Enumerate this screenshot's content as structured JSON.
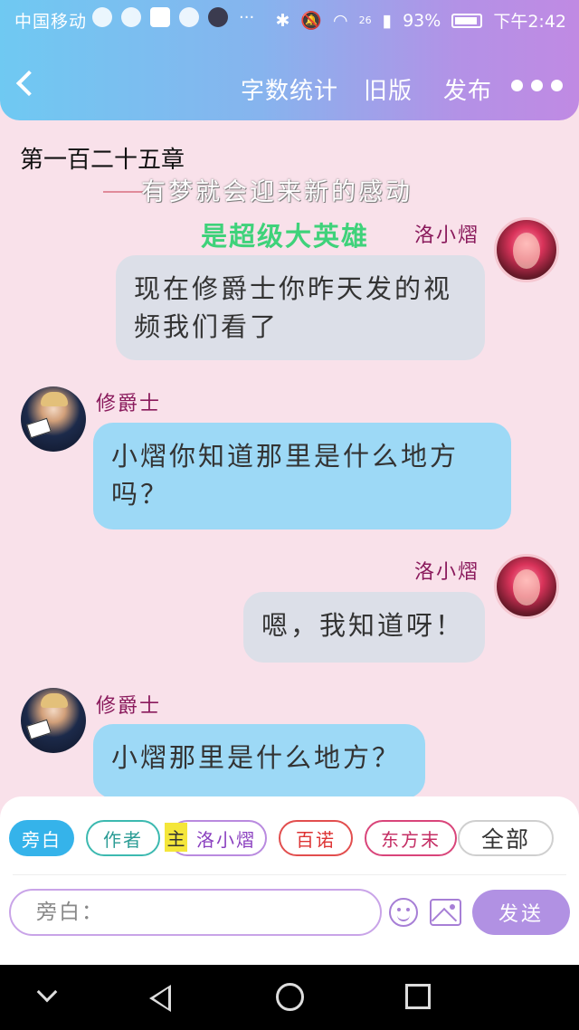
{
  "statusbar": {
    "carrier": "中国移动",
    "dots": "···",
    "network": "26",
    "battery": "93%",
    "time": "下午2:42"
  },
  "header": {
    "word_count": "字数统计",
    "old_version": "旧版",
    "publish": "发布"
  },
  "chapter_title": "第一百二十五章",
  "banners": {
    "line1": "有梦就会迎来新的感动",
    "line2": "是超级大英雄"
  },
  "messages": [
    {
      "speaker": "洛小熠",
      "side": "right",
      "text": "现在修爵士你昨天发的视频我们看了"
    },
    {
      "speaker": "修爵士",
      "side": "left",
      "text": "小熠你知道那里是什么地方吗？"
    },
    {
      "speaker": "洛小熠",
      "side": "right",
      "text": "嗯，我知道呀！"
    },
    {
      "speaker": "修爵士",
      "side": "left",
      "text": "小熠那里是什么地方？"
    }
  ],
  "roles": {
    "narration": "旁白",
    "author": "作者",
    "main_tag": "主",
    "lead": "洛小熠",
    "bainuo": "百诺",
    "dongfang": "东方末",
    "all": "全部"
  },
  "composer": {
    "placeholder": "旁白：",
    "send": "发送"
  },
  "colors": {
    "header_gradient_start": "#6fc9f2",
    "header_gradient_end": "#c08ae3",
    "background": "#f9e1ea",
    "bubble_grey": "#dcdfe8",
    "bubble_blue": "#9dd9f6",
    "speaker_name": "#8a1a5c",
    "send_button": "#b191e3"
  }
}
